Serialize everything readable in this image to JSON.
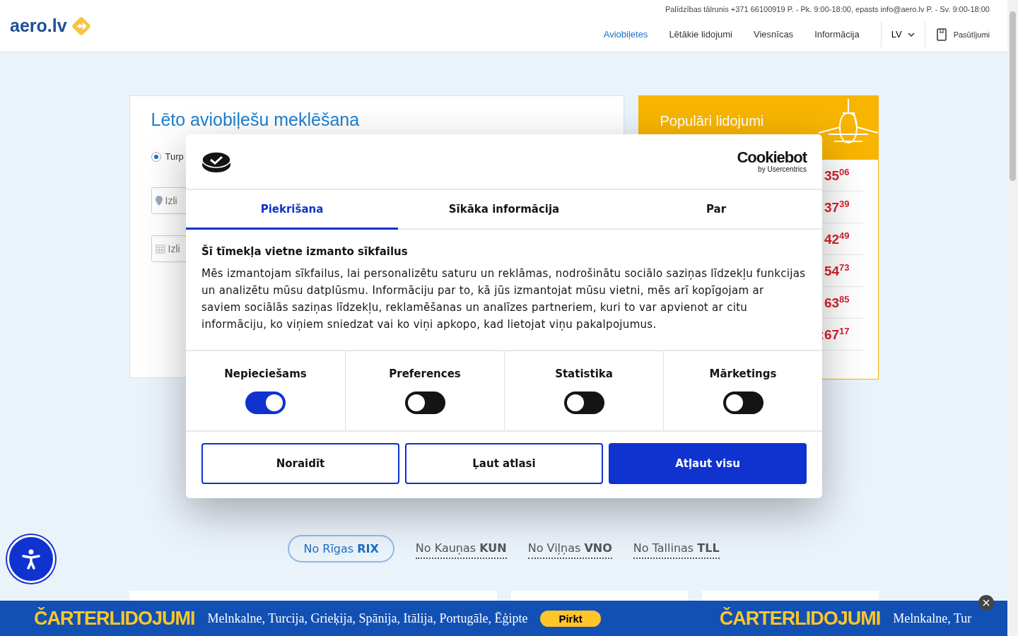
{
  "header": {
    "logo": "aero.lv",
    "contact": "Palīdzības tālrunis +371 66100919 P. - Pk. 9:00-18:00, epasts info@aero.lv P. - Sv. 9:00-18:00",
    "nav": [
      {
        "label": "Aviobiļetes",
        "selected": true
      },
      {
        "label": "Lētākie lidojumi",
        "selected": false
      },
      {
        "label": "Viesnīcas",
        "selected": false
      },
      {
        "label": "Informācija",
        "selected": false
      }
    ],
    "language": "LV",
    "orders": "Pasūtījumi"
  },
  "search": {
    "title": "Lēto aviobiļešu meklēšana",
    "trip_option": {
      "label": "Turp",
      "selected": true
    },
    "from_placeholder": "Izli",
    "date_placeholder": "Izli"
  },
  "popular": {
    "title": "Populāri lidojumi",
    "prices": [
      "35$^{06}$",
      "37$^{39}$",
      "42$^{49}$",
      "54$^{73}$",
      "63$^{85}$",
      ":67$^{17}$"
    ]
  },
  "cookie_dialog": {
    "brand": "Cookiebot",
    "brand_sub": "by Usercentrics",
    "tabs": [
      {
        "label": "Piekrišana",
        "selected": true
      },
      {
        "label": "Sīkāka informācija",
        "selected": false
      },
      {
        "label": "Par",
        "selected": false
      }
    ],
    "heading": "Šī tīmekļa vietne izmanto sīkfailus",
    "body": "Mēs izmantojam sīkfailus, lai personalizētu saturu un reklāmas, nodrošinātu sociālo saziņas līdzekļu funkcijas un analizētu mūsu datplūsmu. Informāciju par to, kā jūs izmantojat mūsu vietni, mēs arī kopīgojam ar saviem sociālās saziņas līdzekļu, reklamēšanas un analīzes partneriem, kuri to var apvienot ar citu informāciju, ko viņiem sniedzat vai ko viņi apkopo, kad lietojat viņu pakalpojumus.",
    "categories": [
      {
        "label": "Nepieciešams",
        "on": true
      },
      {
        "label": "Preferences",
        "on": false
      },
      {
        "label": "Statistika",
        "on": false
      },
      {
        "label": "Mārketings",
        "on": false
      }
    ],
    "buttons": [
      {
        "label": "Noraidīt",
        "kind": "outline"
      },
      {
        "label": "Ļaut atlasi",
        "kind": "outline"
      },
      {
        "label": "Atļaut visu",
        "kind": "primary"
      }
    ]
  },
  "departure_tabs": [
    {
      "label": "No Rīgas **RIX**",
      "selected": true
    },
    {
      "label": "No Kauņas **KUN**",
      "selected": false
    },
    {
      "label": "No Viļņas **VNO**",
      "selected": false
    },
    {
      "label": "No Tallinas **TLL**",
      "selected": false
    }
  ],
  "banner": {
    "title": "ČARTERLIDOJUMI",
    "destinations": "Melnkalne, Turcija, Grieķija, Spānija, Itālija, Portugāle, Ēģipte",
    "button": "Pirkt",
    "title_repeat": "ČARTERLIDOJUMI",
    "destinations_repeat": "Melnkalne, Tur"
  }
}
